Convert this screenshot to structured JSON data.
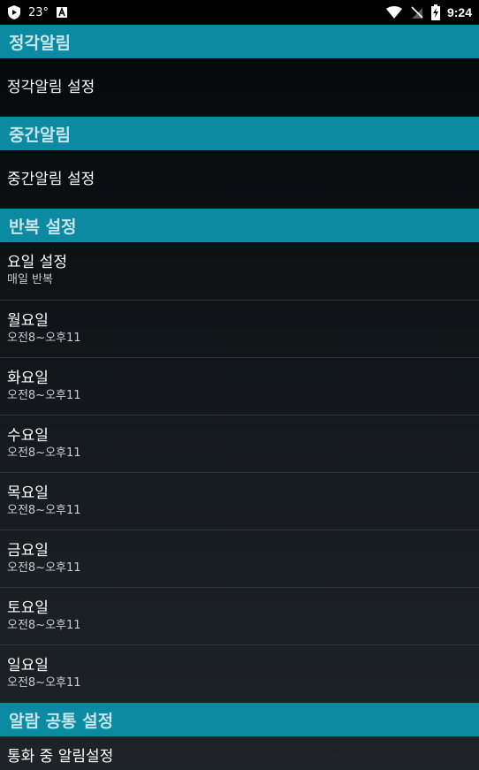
{
  "status_bar": {
    "temperature": "23°",
    "time": "9:24",
    "icons": [
      "shield-play-icon",
      "keyboard-a-icon",
      "wifi-icon",
      "no-sim-icon",
      "battery-charging-icon"
    ]
  },
  "sections": {
    "hourly": {
      "header": "정각알림",
      "row_title": "정각알림 설정"
    },
    "half": {
      "header": "중간알림",
      "row_title": "중간알림 설정"
    },
    "repeat": {
      "header": "반복 설정",
      "day_setting": {
        "title": "요일 설정",
        "summary": "매일 반복"
      },
      "days": [
        {
          "title": "월요일",
          "summary": "오전8~오후11"
        },
        {
          "title": "화요일",
          "summary": "오전8~오후11"
        },
        {
          "title": "수요일",
          "summary": "오전8~오후11"
        },
        {
          "title": "목요일",
          "summary": "오전8~오후11"
        },
        {
          "title": "금요일",
          "summary": "오전8~오후11"
        },
        {
          "title": "토요일",
          "summary": "오전8~오후11"
        },
        {
          "title": "일요일",
          "summary": "오전8~오후11"
        }
      ]
    },
    "common": {
      "header": "알람 공통 설정",
      "row_title": "통화 중 알림설정"
    }
  },
  "colors": {
    "header_bg": "#0c8aa1",
    "header_text": "#c6e4ea",
    "status_bar_bg": "#000000"
  }
}
